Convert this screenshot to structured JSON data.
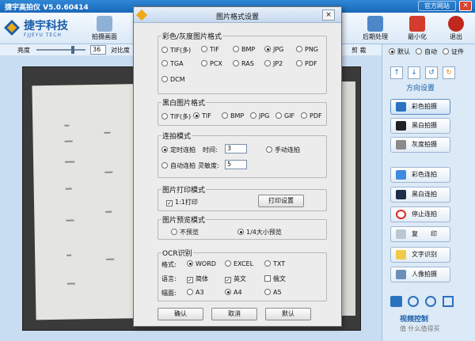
{
  "app": {
    "title": "捷宇高拍仪 V5.0.60414",
    "official_site": "官方网站",
    "close": "×"
  },
  "logo": {
    "name": "捷宇科技",
    "sub": "FJJEYU TECH"
  },
  "toolbar": {
    "items": [
      {
        "label": "拍摄画面",
        "color": "#8fb1d6"
      },
      {
        "label": "后期处理",
        "color": "#4e87c8"
      },
      {
        "label": "最小化",
        "color": "#d33b2c"
      },
      {
        "label": "退出",
        "color": "#c0281e"
      }
    ]
  },
  "controls": {
    "brightness_label": "亮度",
    "brightness_value": "36",
    "contrast_label": "对比度",
    "cut_label": "剪 裁",
    "mode_options": [
      "默认",
      "自动",
      "证件"
    ],
    "selected_mode": "默认"
  },
  "right_panel": {
    "direction_label": "方向设置",
    "buttons": [
      "彩色拍摄",
      "黑白拍摄",
      "灰度拍摄",
      "彩色连拍",
      "黑白连拍",
      "停止连拍",
      "复　　印",
      "文字识别",
      "人像拍摄"
    ],
    "video_label": "视频控制",
    "watermark": "值 什么值得买"
  },
  "dialog": {
    "title": "图片格式设置",
    "close": "×",
    "color_format": {
      "legend": "彩色/灰度图片格式",
      "options": [
        "TIF(多)",
        "TIF",
        "BMP",
        "JPG",
        "PNG",
        "TGA",
        "PCX",
        "RAS",
        "JP2",
        "PDF",
        "DCM"
      ],
      "selected": "JPG"
    },
    "bw_format": {
      "legend": "黑白图片格式",
      "options": [
        "TIF(多)",
        "TIF",
        "BMP",
        "JPG",
        "GIF",
        "PDF"
      ],
      "selected": "TIF"
    },
    "burst": {
      "legend": "连拍模式",
      "timed": "定时连拍",
      "time_label": "时间:",
      "time_value": "3",
      "manual": "手动连拍",
      "auto": "自动连拍",
      "sens_label": "灵敏度:",
      "sens_value": "5",
      "selected": "定时连拍"
    },
    "print": {
      "legend": "图片打印模式",
      "checkbox": "1:1打印",
      "checked": true,
      "settings_button": "打印设置"
    },
    "preview": {
      "legend": "图片预览模式",
      "options": [
        "不预览",
        "1/4大小预览"
      ],
      "selected": "1/4大小预览"
    },
    "ocr": {
      "legend": "OCR识别",
      "format_label": "格式:",
      "formats": [
        "WORD",
        "EXCEL",
        "TXT"
      ],
      "format_selected": "WORD",
      "lang_label": "语言:",
      "languages": [
        "简体",
        "英文",
        "俄文"
      ],
      "lang_checked": [
        true,
        true,
        false
      ],
      "page_label": "幅面:",
      "pages": [
        "A3",
        "A4",
        "A5"
      ],
      "page_selected": "A4"
    },
    "buttons": {
      "ok": "确认",
      "cancel": "取消",
      "default": "默认"
    }
  }
}
